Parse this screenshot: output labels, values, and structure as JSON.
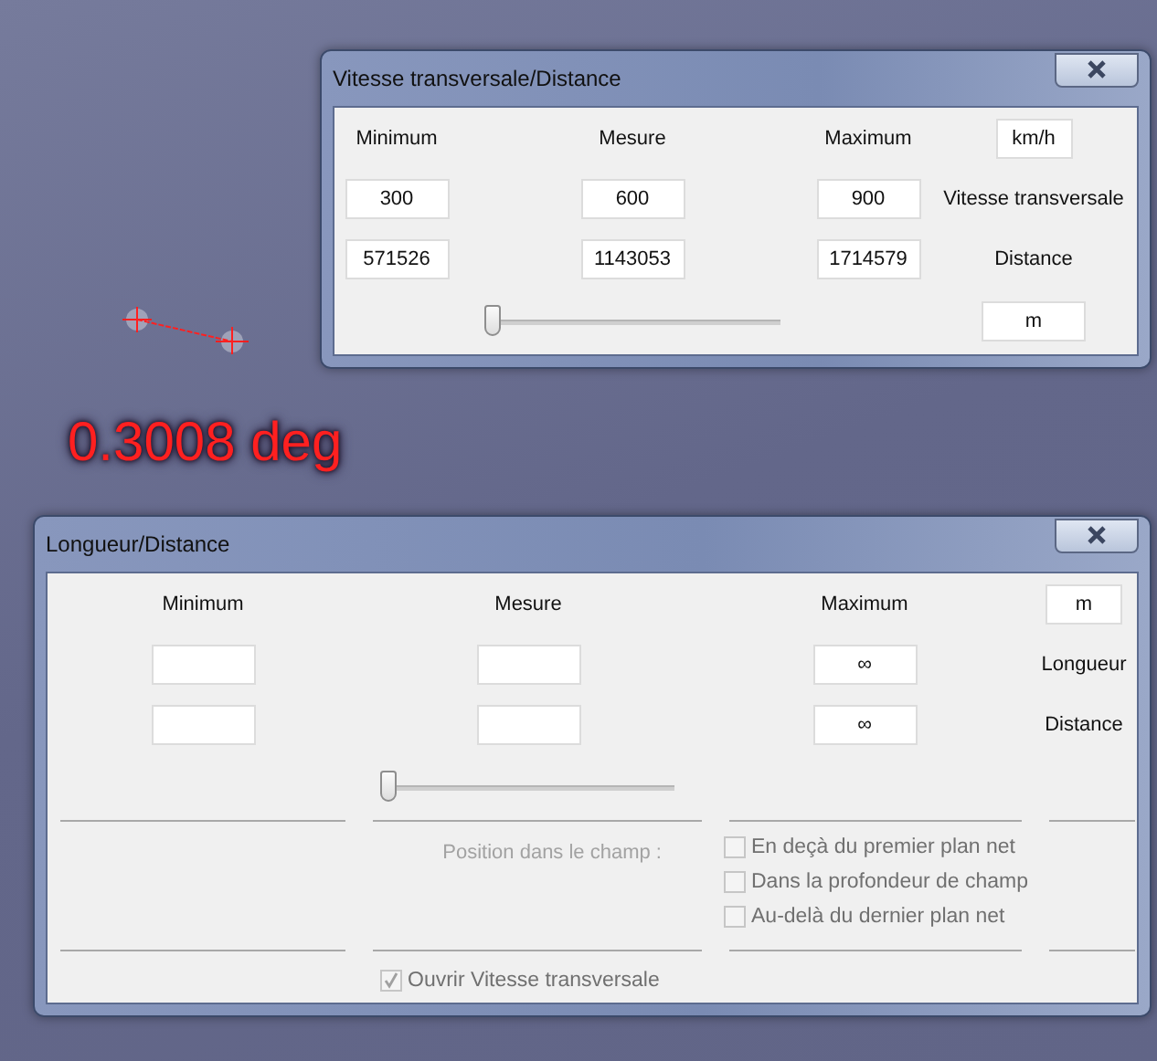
{
  "measure_overlay": {
    "reading": "0.3008 deg"
  },
  "windows": [
    {
      "title": "Vitesse transversale/Distance",
      "headers": [
        "Minimum",
        "Mesure",
        "Maximum"
      ],
      "unit_top": "km/h",
      "rows": [
        {
          "label": "Vitesse transversale",
          "minimum": "300",
          "measure": "600",
          "maximum": "900"
        },
        {
          "label": "Distance",
          "minimum": "571526",
          "measure": "1143053",
          "maximum": "1714579"
        }
      ],
      "slider": {
        "level": 0
      },
      "unit_bottom": "m"
    },
    {
      "title": "Longueur/Distance",
      "headers": [
        "Minimum",
        "Mesure",
        "Maximum"
      ],
      "unit_top": "m",
      "rows": [
        {
          "label": "Longueur",
          "maximum": "∞"
        },
        {
          "label": "Distance",
          "maximum": "∞"
        }
      ],
      "slider": {
        "level": 0
      },
      "position_label": {
        "text": "Position dans le champ :",
        "disabled": true
      },
      "position_options": [
        {
          "label": "En deçà du premier plan net",
          "checked": false,
          "disabled": true
        },
        {
          "label": "Dans la profondeur de champ",
          "checked": false,
          "disabled": true
        },
        {
          "label": "Au-delà du dernier plan net",
          "checked": false,
          "disabled": true
        }
      ],
      "open_option": {
        "label": "Ouvrir Vitesse transversale",
        "checked": true,
        "disabled": true
      }
    }
  ]
}
